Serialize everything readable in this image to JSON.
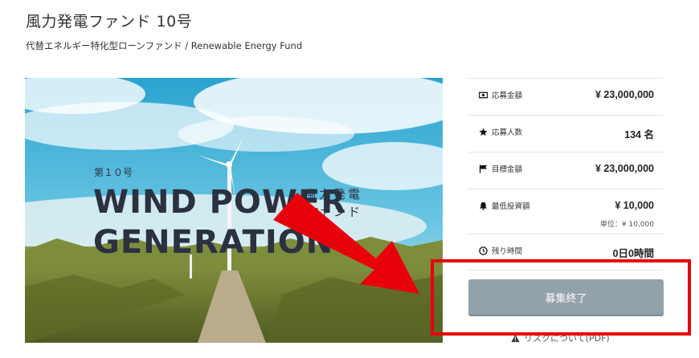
{
  "page": {
    "title": "風力発電ファンド 10号",
    "subtitle": "代替エネルギー特化型ローンファンド / Renewable Energy Fund"
  },
  "hero": {
    "issue_label": "第１０号",
    "headline_line1": "WIND POWER",
    "headline_line2": "GENERATION",
    "jp_line1": "風力発電",
    "jp_line2": "ファンド"
  },
  "stats": [
    {
      "icon": "money-icon",
      "label": "応募金額",
      "value": "¥ 23,000,000"
    },
    {
      "icon": "star-icon",
      "label": "応募人数",
      "value": "134 名"
    },
    {
      "icon": "flag-icon",
      "label": "目標金額",
      "value": "¥ 23,000,000"
    },
    {
      "icon": "bell-icon",
      "label": "最低投資額",
      "value": "¥ 10,000",
      "sub": "単位：¥ 10,000"
    },
    {
      "icon": "clock-icon",
      "label": "残り時間",
      "value": "0日0時間"
    }
  ],
  "action": {
    "button_label": "募集終了",
    "risk_link": "リスクについて(PDF)"
  },
  "colors": {
    "button": "#93a1ab",
    "highlight": "#e8000b",
    "sky": "#3fb3d6",
    "field": "#6d7a2e"
  }
}
